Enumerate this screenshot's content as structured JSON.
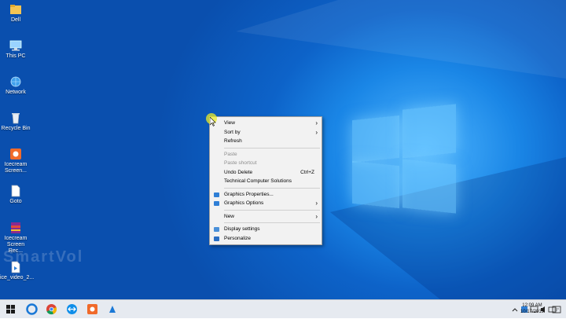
{
  "desktop": {
    "icons": [
      {
        "label": "Dell",
        "icon": "folder-icon"
      },
      {
        "label": "This PC",
        "icon": "computer-icon"
      },
      {
        "label": "Network",
        "icon": "network-icon"
      },
      {
        "label": "Recycle Bin",
        "icon": "recycle-bin-icon"
      },
      {
        "label": "Icecream Screen...",
        "icon": "icecream-icon"
      },
      {
        "label": "Goto",
        "icon": "file-icon"
      },
      {
        "label": "Icecream Screen Rec...",
        "icon": "winrar-icon"
      },
      {
        "label": "ice_video_2...",
        "icon": "video-file-icon"
      }
    ],
    "watermark": "SmartVol"
  },
  "context_menu": {
    "items": [
      {
        "label": "View",
        "submenu": true
      },
      {
        "label": "Sort by",
        "submenu": true
      },
      {
        "label": "Refresh"
      },
      {
        "label": "Paste",
        "disabled": true
      },
      {
        "label": "Paste shortcut",
        "disabled": true
      },
      {
        "label": "Undo Delete",
        "shortcut": "Ctrl+Z"
      },
      {
        "label": "Technical Computer Solutions"
      },
      {
        "label": "Graphics Properties...",
        "icon": "graphics-icon"
      },
      {
        "label": "Graphics Options",
        "icon": "graphics-icon",
        "submenu": true
      },
      {
        "label": "New",
        "submenu": true
      },
      {
        "label": "Display settings",
        "icon": "display-icon"
      },
      {
        "label": "Personalize",
        "icon": "personalize-icon"
      }
    ]
  },
  "taskbar": {
    "apps": [
      "start-icon",
      "edge-icon",
      "chrome-icon",
      "teamviewer-icon",
      "icecream-icon",
      "app-icon"
    ],
    "time": "12:09 AM",
    "date": "10/17/2019"
  },
  "colors": {
    "accent": "#0d63c9",
    "menu_bg": "#f2f2f2",
    "taskbar_bg": "#e6eaf0"
  }
}
